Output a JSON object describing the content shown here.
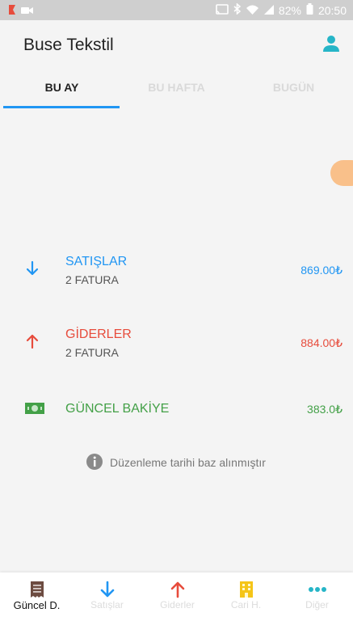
{
  "status_bar": {
    "battery": "82%",
    "time": "20:50"
  },
  "app_bar": {
    "title": "Buse Tekstil",
    "profile_icon": "person-icon"
  },
  "tabs": [
    {
      "label": "BU AY",
      "active": true
    },
    {
      "label": "BU HAFTA",
      "active": false
    },
    {
      "label": "BUGÜN",
      "active": false
    }
  ],
  "summary": {
    "sales": {
      "title": "SATIŞLAR",
      "subtitle": "2 FATURA",
      "amount": "869.00₺",
      "color": "#2196f3",
      "icon": "arrow-down-icon"
    },
    "expenses": {
      "title": "GİDERLER",
      "subtitle": "2 FATURA",
      "amount": "884.00₺",
      "color": "#e74c3c",
      "icon": "arrow-up-icon"
    },
    "balance": {
      "title": "GÜNCEL BAKİYE",
      "amount": "383.0₺",
      "color": "#43a047",
      "icon": "cash-icon"
    }
  },
  "note": {
    "text": "Düzenleme tarihi baz alınmıştır",
    "icon": "info-icon"
  },
  "bottom_nav": [
    {
      "label": "Güncel D.",
      "icon": "receipt-icon",
      "active": true
    },
    {
      "label": "Satışlar",
      "icon": "arrow-down-icon",
      "active": false
    },
    {
      "label": "Giderler",
      "icon": "arrow-up-icon",
      "active": false
    },
    {
      "label": "Cari H.",
      "icon": "building-icon",
      "active": false
    },
    {
      "label": "Diğer",
      "icon": "more-dots-icon",
      "active": false
    }
  ]
}
